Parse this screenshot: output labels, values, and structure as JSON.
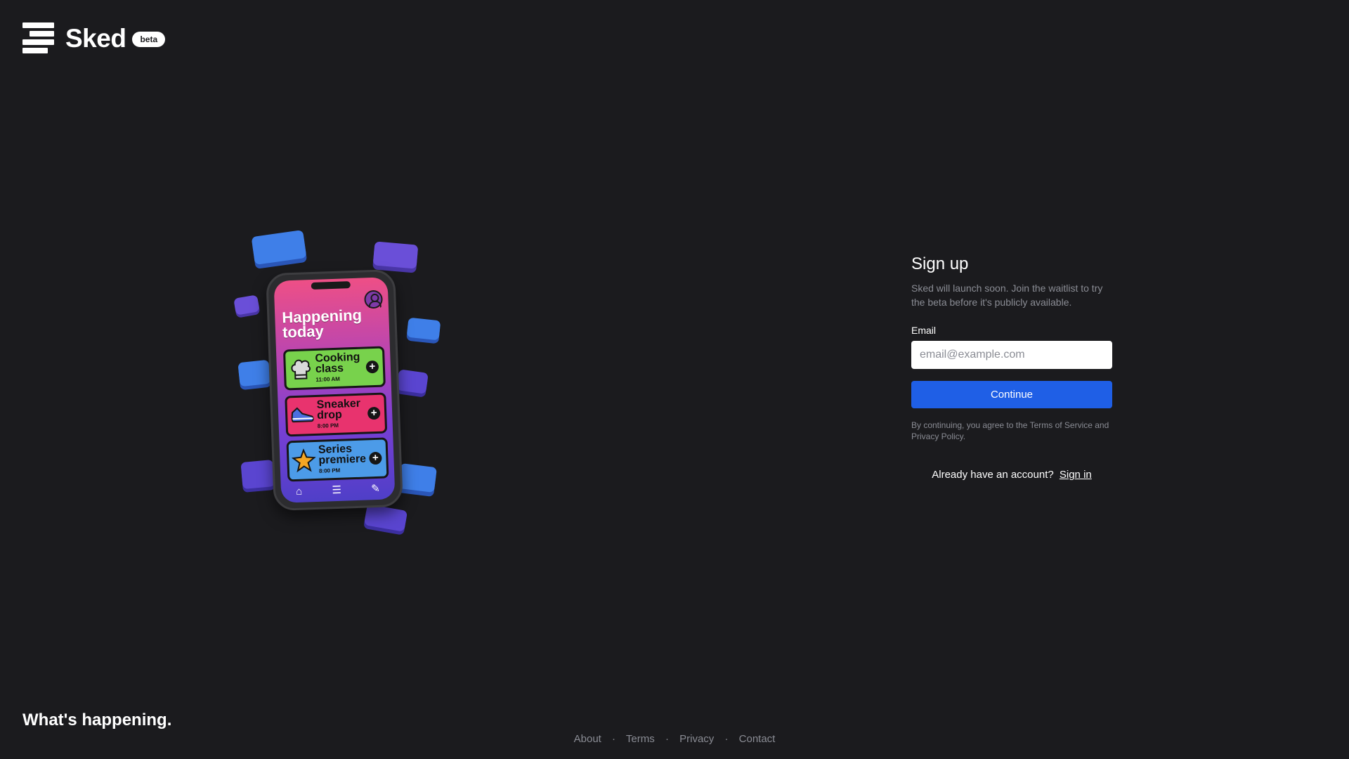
{
  "header": {
    "app_name": "Sked",
    "badge": "beta"
  },
  "illustration": {
    "screen_title": "Happening today",
    "events": [
      {
        "name": "Cooking class",
        "time": "11:00 AM",
        "icon": "chef-hat-icon",
        "color": "#78d24c"
      },
      {
        "name": "Sneaker drop",
        "time": "8:00 PM",
        "icon": "sneaker-icon",
        "color": "#e8336e"
      },
      {
        "name": "Series premiere",
        "time": "8:00 PM",
        "icon": "star-icon",
        "color": "#4c9be8"
      }
    ],
    "nav_icons": [
      "home-icon",
      "list-icon",
      "pencil-icon"
    ]
  },
  "signup": {
    "title": "Sign up",
    "subtitle": "Sked will launch soon. Join the waitlist to try the beta before it's publicly available.",
    "email_label": "Email",
    "email_placeholder": "email@example.com",
    "email_value": "",
    "continue_label": "Continue",
    "legal": "By continuing, you agree to the Terms of Service and Privacy Policy.",
    "signin_prompt": "Already have an account?",
    "signin_link": "Sign in"
  },
  "footer": {
    "tagline": "What's happening.",
    "links": [
      "About",
      "Terms",
      "Privacy",
      "Contact"
    ],
    "separator": "·"
  },
  "colors": {
    "background": "#1b1b1e",
    "accent": "#1f5fe6",
    "muted_text": "#8a8c94"
  }
}
